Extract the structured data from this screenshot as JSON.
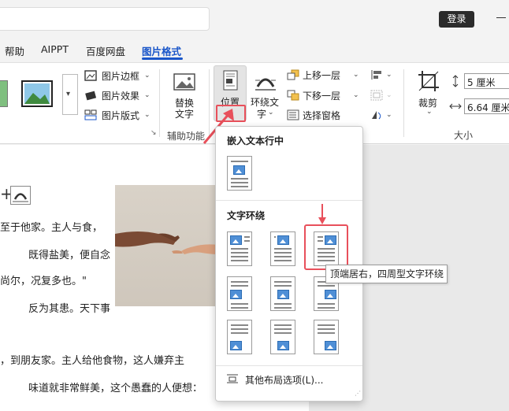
{
  "titlebar": {
    "login_label": "登录"
  },
  "tabs": [
    {
      "label": "帮助"
    },
    {
      "label": "AIPPT"
    },
    {
      "label": "百度网盘"
    },
    {
      "label": "图片格式",
      "active": true
    }
  ],
  "ribbon": {
    "picture_styles": {
      "border_label": "图片边框",
      "effects_label": "图片效果",
      "layout_label": "图片版式"
    },
    "accessibility": {
      "alt_text_line1": "替换",
      "alt_text_line2": "文字",
      "group_label": "辅助功能"
    },
    "arrange": {
      "position_label": "位置",
      "wrap_line1": "环绕文",
      "wrap_line2": "字",
      "bring_forward": "上移一层",
      "send_backward": "下移一层",
      "selection_pane": "选择窗格"
    },
    "size": {
      "crop_label": "裁剪",
      "height_value": "5 厘米",
      "width_value": "6.64 厘米",
      "group_label": "大小"
    }
  },
  "document": {
    "lines": [
      "至于他家。主人与食，",
      "既得盐美，便自念",
      "尚尔，况复多也。\"",
      "反为其患。天下事",
      "，到朋友家。主人给他食物，这人嫌弃主",
      "味道就非常鲜美，这个愚蠢的人便想："
    ]
  },
  "position_menu": {
    "inline_title": "嵌入文本行中",
    "wrap_title": "文字环绕",
    "more_options": "其他布局选项(L)...",
    "tooltip": "顶端居右，四周型文字环绕"
  },
  "colors": {
    "accent": "#1a56c9",
    "highlight": "#e8505b"
  }
}
